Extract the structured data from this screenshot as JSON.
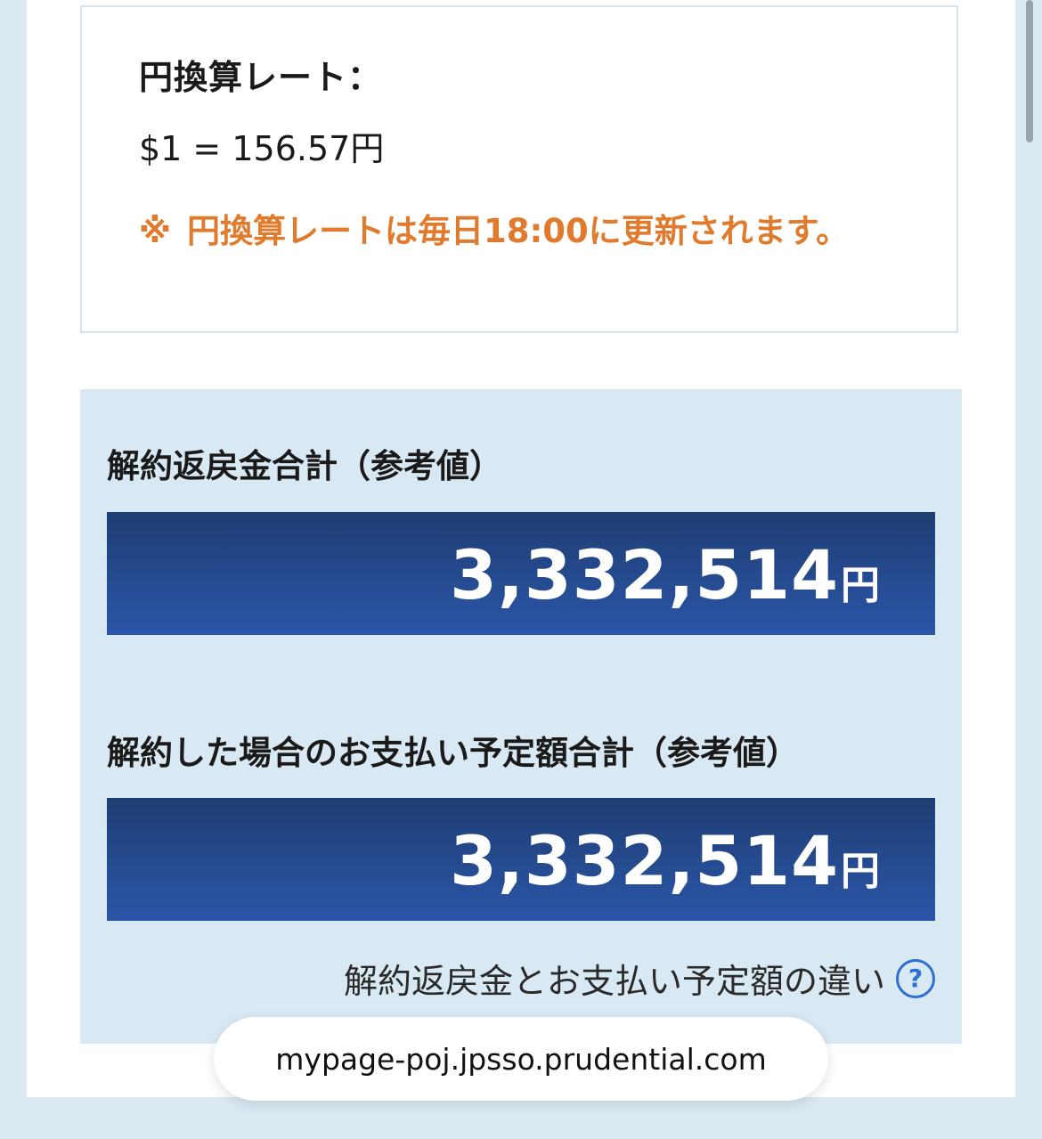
{
  "rate": {
    "title": "円換算レート：",
    "value": "$1 = 156.57円",
    "note_mark": "※",
    "note_text": "円換算レートは毎日18:00に更新されます。"
  },
  "surrender_total": {
    "label": "解約返戻金合計（参考値）",
    "amount": "3,332,514",
    "unit": "円"
  },
  "payment_total": {
    "label": "解約した場合のお支払い予定額合計（参考値）",
    "amount": "3,332,514",
    "unit": "円"
  },
  "help": {
    "text": "解約返戻金とお支払い予定額の違い",
    "icon": "?"
  },
  "browser": {
    "url": "mypage-poj.jpsso.prudential.com"
  },
  "colors": {
    "note": "#e07b2e",
    "bar_top": "#1e3d72",
    "bar_bottom": "#2b56a8",
    "section_bg": "#d9e9f3",
    "help_icon": "#2f6fd4"
  }
}
